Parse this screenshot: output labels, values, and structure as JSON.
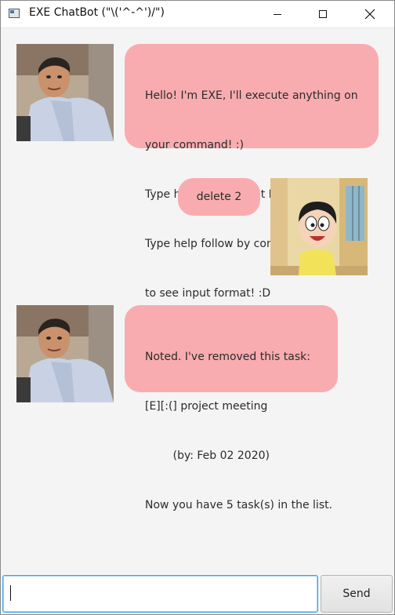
{
  "window": {
    "title": "EXE ChatBot (\"\\('^-^')/\")"
  },
  "messages": [
    {
      "sender": "bot",
      "lines": [
        "Hello! I'm EXE, I'll execute anything on",
        "your command! :)",
        "Type help to see what I can do for you!",
        "Type help follow by command keyword",
        "to see input format! :D"
      ]
    },
    {
      "sender": "user",
      "lines": [
        "delete 2"
      ]
    },
    {
      "sender": "bot",
      "lines": [
        "Noted. I've removed this task:",
        "[E][:(] project meeting",
        "        (by: Feb 02 2020)",
        "Now you have 5 task(s) in the list."
      ]
    }
  ],
  "input": {
    "value": "",
    "send_label": "Send"
  },
  "colors": {
    "bubble": "#f9acb0",
    "input_focus": "#39a7e8"
  }
}
